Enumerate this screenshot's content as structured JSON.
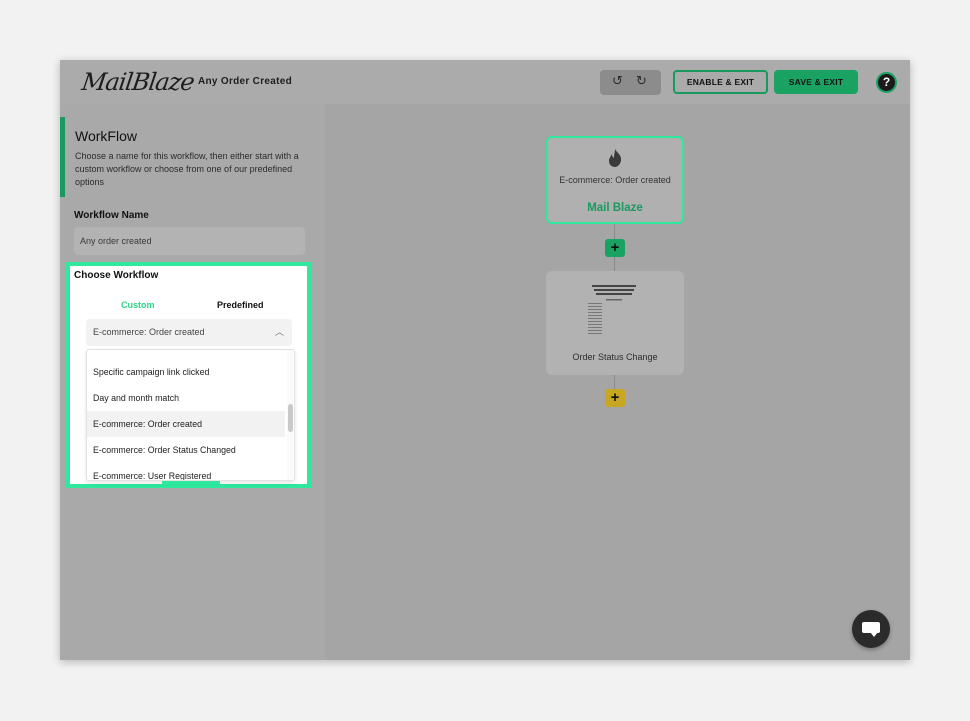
{
  "header": {
    "logo_text": "MailBlaze",
    "document_title": "Any Order Created",
    "undo_icon": "undo-icon",
    "redo_icon": "redo-icon",
    "enable_label": "ENABLE & EXIT",
    "save_label": "SAVE & EXIT",
    "help_icon": "help-icon"
  },
  "sidebar": {
    "heading": "WorkFlow",
    "description": "Choose a name for this workflow, then either start with a custom workflow or choose from one of our predefined options",
    "name_label": "Workflow Name",
    "name_value": "Any order created",
    "choose_label": "Choose Workflow",
    "tabs": {
      "custom": "Custom",
      "predefined": "Predefined"
    },
    "selected": "E-commerce: Order created",
    "options": [
      "Specific campaign link clicked",
      "Day and month match",
      "E-commerce: Order created",
      "E-commerce: Order Status Changed",
      "E-commerce: User Registered"
    ],
    "active_option_index": 2
  },
  "canvas": {
    "trigger": {
      "icon": "flame-icon",
      "text": "E-commerce: Order created",
      "brand": "Mail Blaze"
    },
    "email_node": {
      "label": "Order Status Change"
    }
  },
  "colors": {
    "accent_green": "#1aa263",
    "highlight_green": "#2ee89e",
    "add_yellow": "#c9a620"
  }
}
